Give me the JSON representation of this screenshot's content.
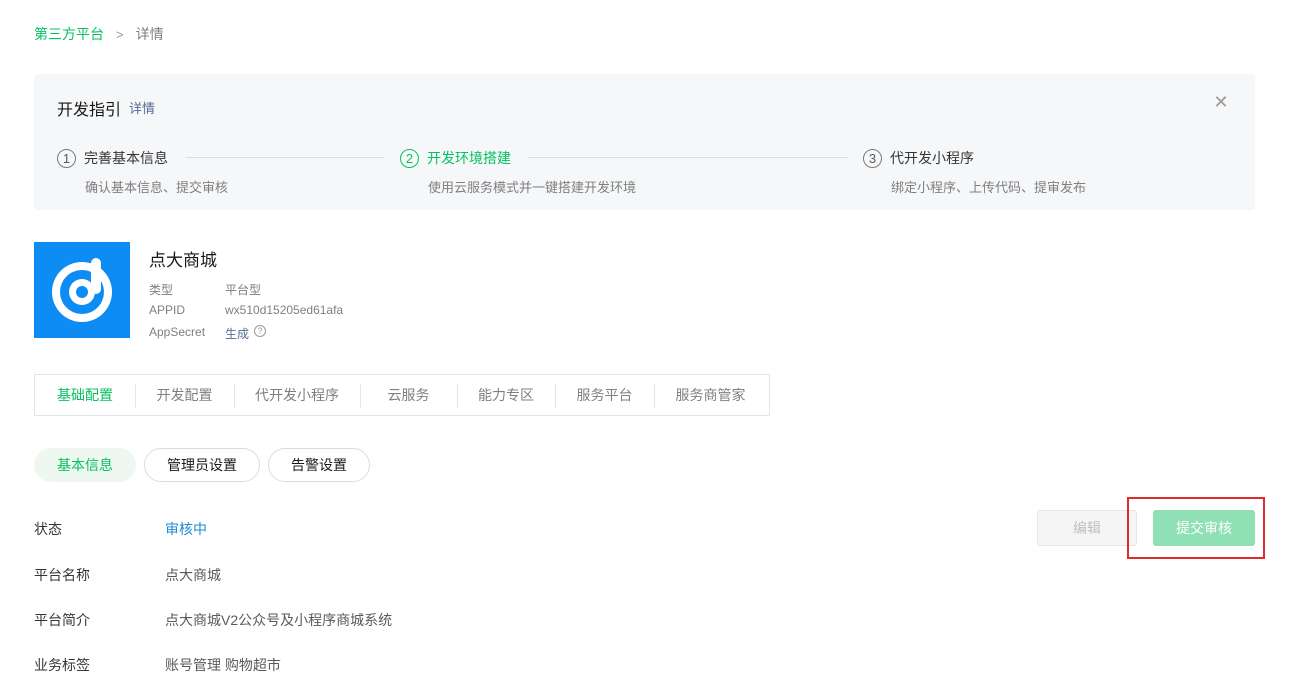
{
  "breadcrumb": {
    "root": "第三方平台",
    "separator": ">",
    "current": "详情"
  },
  "guide": {
    "title": "开发指引",
    "detail_link": "详情",
    "steps": [
      {
        "num": "1",
        "title": "完善基本信息",
        "desc": "确认基本信息、提交审核"
      },
      {
        "num": "2",
        "title": "开发环境搭建",
        "desc": "使用云服务模式并一键搭建开发环境"
      },
      {
        "num": "3",
        "title": "代开发小程序",
        "desc": "绑定小程序、上传代码、提审发布"
      }
    ]
  },
  "app": {
    "name": "点大商城",
    "type_label": "类型",
    "type_value": "平台型",
    "appid_label": "APPID",
    "appid_value": "wx510d15205ed61afa",
    "secret_label": "AppSecret",
    "secret_value": "生成",
    "help_icon": "question-circle-icon"
  },
  "tabs": [
    "基础配置",
    "开发配置",
    "代开发小程序",
    "云服务",
    "能力专区",
    "服务平台",
    "服务商管家"
  ],
  "pills": [
    "基本信息",
    "管理员设置",
    "告警设置"
  ],
  "info": {
    "status_label": "状态",
    "status_value": "审核中",
    "name_label": "平台名称",
    "name_value": "点大商城",
    "intro_label": "平台简介",
    "intro_value": "点大商城V2公众号及小程序商城系统",
    "tags_label": "业务标签",
    "tags_value": "账号管理 购物超市"
  },
  "actions": {
    "edit": "编辑",
    "submit": "提交审核"
  },
  "colors": {
    "accent": "#07c160",
    "link": "#576b95",
    "status": "#1f8bd6",
    "logo_bg": "#0d8cf4",
    "highlight": "#e02b2b"
  }
}
